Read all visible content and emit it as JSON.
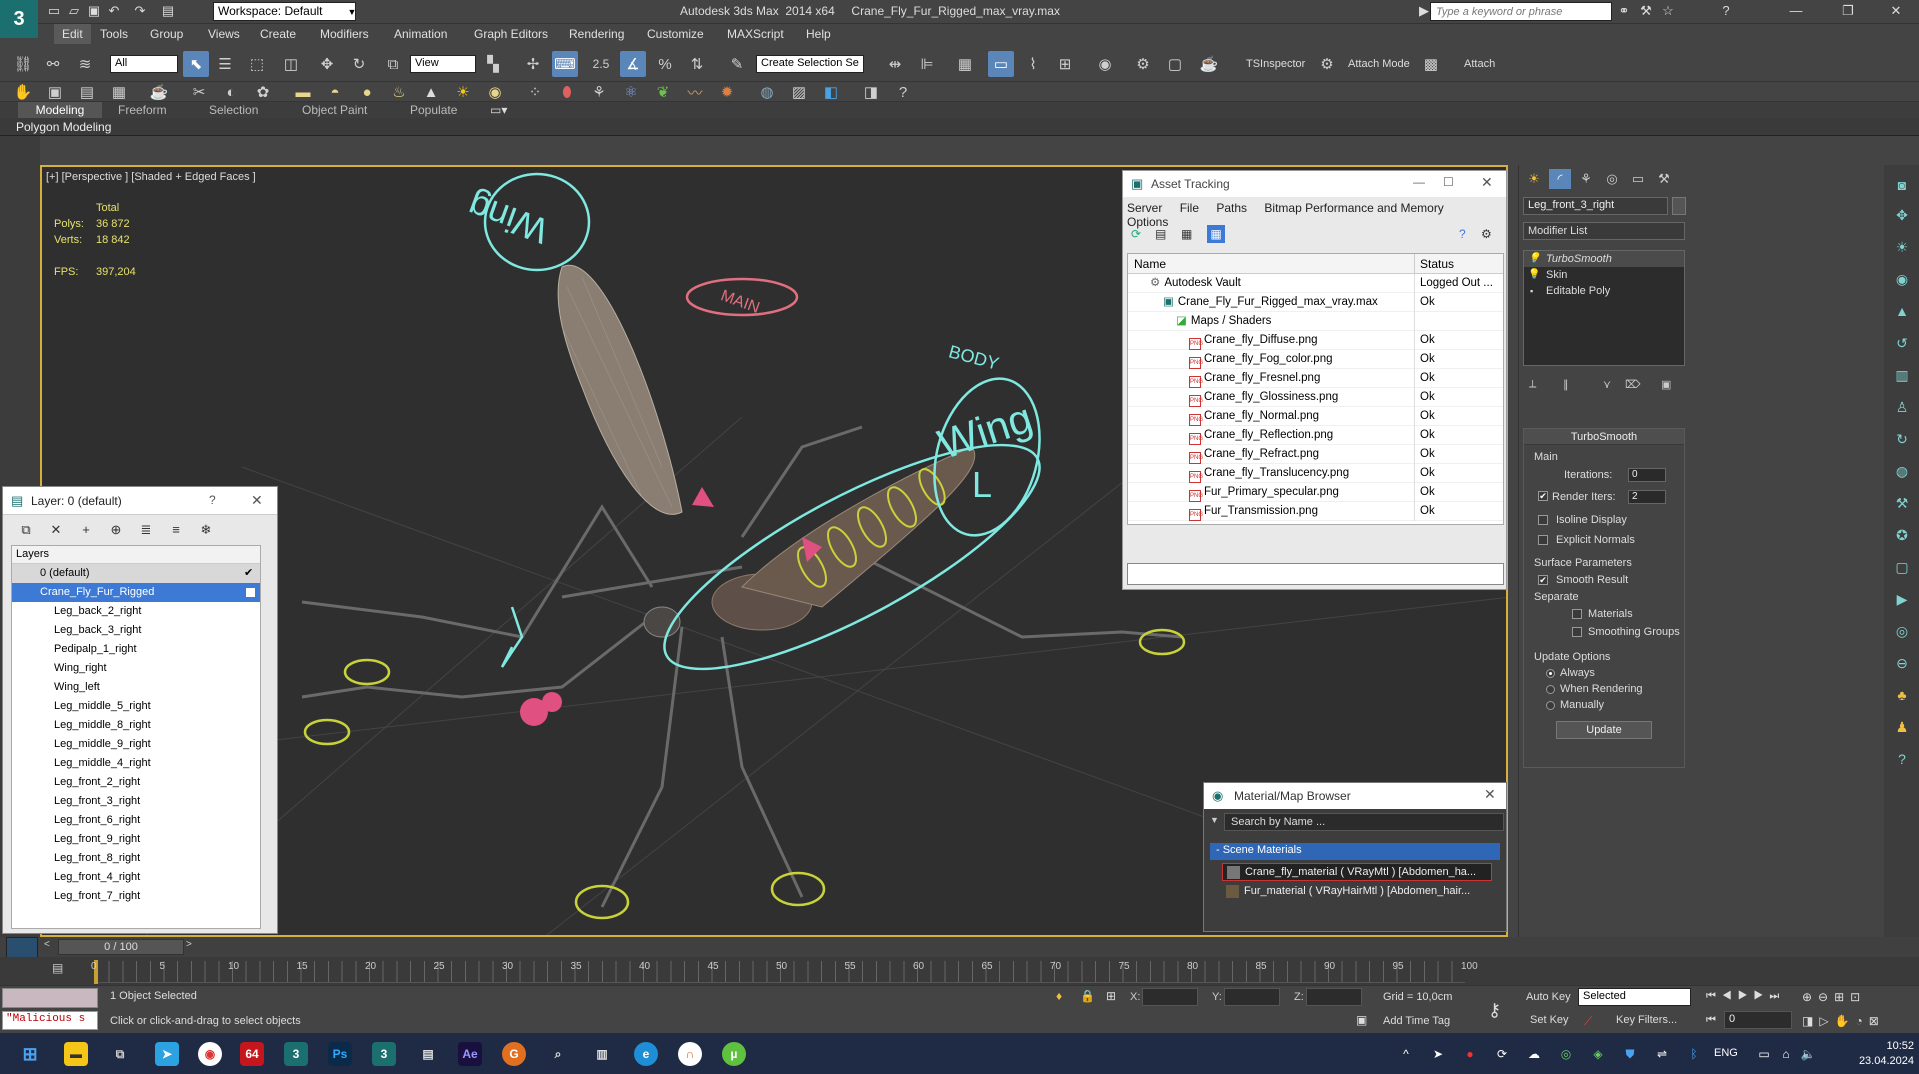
{
  "title_bar": {
    "workspace": "Workspace: Default",
    "window_title": "Autodesk 3ds Max  2014 x64     Crane_Fly_Fur_Rigged_max_vray.max",
    "search_placeholder": "Type a keyword or phrase"
  },
  "menu": [
    "Edit",
    "Tools",
    "Group",
    "Views",
    "Create",
    "Modifiers",
    "Animation",
    "Graph Editors",
    "Rendering",
    "Customize",
    "MAXScript",
    "Help"
  ],
  "toolbar": {
    "selection_filter": "All",
    "ref_coord": "View",
    "named_selection": "Create Selection Se",
    "ts_inspector": "TSInspector",
    "attach_mode": "Attach Mode",
    "attach": "Attach",
    "snap_value": "2.5"
  },
  "ribbon": {
    "tabs": [
      "Modeling",
      "Freeform",
      "Selection",
      "Object Paint",
      "Populate"
    ],
    "panel_label": "Polygon Modeling"
  },
  "viewport": {
    "label": "[+] [Perspective ] [Shaded + Edged Faces ]",
    "stats": {
      "total_label": "Total",
      "polys_label": "Polys:",
      "polys": "36 872",
      "verts_label": "Verts:",
      "verts": "18 842",
      "fps_label": "FPS:",
      "fps": "397,204"
    },
    "rig_labels": [
      "Wing",
      "Wing",
      "L",
      "MAIN",
      "BODY"
    ]
  },
  "layer_panel": {
    "title": "Layer: 0 (default)",
    "help": "?",
    "column": "Layers",
    "default_layer": "0 (default)",
    "selected_layer": "Crane_Fly_Fur_Rigged",
    "children": [
      "Leg_back_2_right",
      "Leg_back_3_right",
      "Pedipalp_1_right",
      "Wing_right",
      "Wing_left",
      "Leg_middle_5_right",
      "Leg_middle_8_right",
      "Leg_middle_9_right",
      "Leg_middle_4_right",
      "Leg_front_2_right",
      "Leg_front_3_right",
      "Leg_front_6_right",
      "Leg_front_9_right",
      "Leg_front_8_right",
      "Leg_front_4_right",
      "Leg_front_7_right"
    ]
  },
  "asset_tracking": {
    "title": "Asset Tracking",
    "menu": [
      "Server",
      "File",
      "Paths",
      "Bitmap Performance and Memory",
      "Options"
    ],
    "col_name": "Name",
    "col_status": "Status",
    "rows": [
      {
        "name": "Autodesk Vault",
        "status": "Logged Out ...",
        "level": 0
      },
      {
        "name": "Crane_Fly_Fur_Rigged_max_vray.max",
        "status": "Ok",
        "level": 1
      },
      {
        "name": "Maps / Shaders",
        "status": "",
        "level": 2
      },
      {
        "name": "Crane_fly_Diffuse.png",
        "status": "Ok",
        "level": 3
      },
      {
        "name": "Crane_fly_Fog_color.png",
        "status": "Ok",
        "level": 3
      },
      {
        "name": "Crane_fly_Fresnel.png",
        "status": "Ok",
        "level": 3
      },
      {
        "name": "Crane_fly_Glossiness.png",
        "status": "Ok",
        "level": 3
      },
      {
        "name": "Crane_fly_Normal.png",
        "status": "Ok",
        "level": 3
      },
      {
        "name": "Crane_fly_Reflection.png",
        "status": "Ok",
        "level": 3
      },
      {
        "name": "Crane_fly_Refract.png",
        "status": "Ok",
        "level": 3
      },
      {
        "name": "Crane_fly_Translucency.png",
        "status": "Ok",
        "level": 3
      },
      {
        "name": "Fur_Primary_specular.png",
        "status": "Ok",
        "level": 3
      },
      {
        "name": "Fur_Transmission.png",
        "status": "Ok",
        "level": 3
      }
    ]
  },
  "material_browser": {
    "title": "Material/Map Browser",
    "search_placeholder": "Search by Name ...",
    "group": "- Scene Materials",
    "items": [
      "Crane_fly_material  ( VRayMtl ) [Abdomen_ha...",
      "Fur_material  ( VRayHairMtl ) [Abdomen_hair..."
    ]
  },
  "command_panel": {
    "object_name": "Leg_front_3_right",
    "modifier_list": "Modifier List",
    "stack": [
      "TurboSmooth",
      "Skin",
      "Editable Poly"
    ],
    "rollout": "TurboSmooth",
    "main": "Main",
    "iterations_label": "Iterations:",
    "iterations": "0",
    "render_iters_label": "Render Iters:",
    "render_iters": "2",
    "isoline": "Isoline Display",
    "explicit_normals": "Explicit Normals",
    "surface_params": "Surface Parameters",
    "smooth_result": "Smooth Result",
    "separate": "Separate",
    "materials": "Materials",
    "smoothing_groups": "Smoothing Groups",
    "update_options": "Update Options",
    "always": "Always",
    "when_rendering": "When Rendering",
    "manually": "Manually",
    "update": "Update"
  },
  "timeline": {
    "frame": "0 / 100",
    "ticks": [
      "0",
      "5",
      "10",
      "15",
      "20",
      "25",
      "30",
      "35",
      "40",
      "45",
      "50",
      "55",
      "60",
      "65",
      "70",
      "75",
      "80",
      "85",
      "90",
      "95",
      "100"
    ]
  },
  "status": {
    "script": "\"Malicious s",
    "selection": "1 Object Selected",
    "prompt": "Click or click-and-drag to select objects",
    "x": "X:",
    "y": "Y:",
    "z": "Z:",
    "grid": "Grid = 10,0cm",
    "add_time_tag": "Add Time Tag",
    "auto_key": "Auto Key",
    "set_key": "Set Key",
    "selected": "Selected",
    "key_filters": "Key Filters...",
    "frame_value": "0"
  },
  "taskbar": {
    "lang": "ENG",
    "time": "10:52",
    "date": "23.04.2024",
    "badge": "64"
  },
  "colors": {
    "rig_cyan": "#7fe8e0",
    "rig_yellow": "#c8d23a",
    "rig_pink": "#e05080",
    "viewport_border": "#d6b03b",
    "selection_blue": "#3c7ad6"
  }
}
